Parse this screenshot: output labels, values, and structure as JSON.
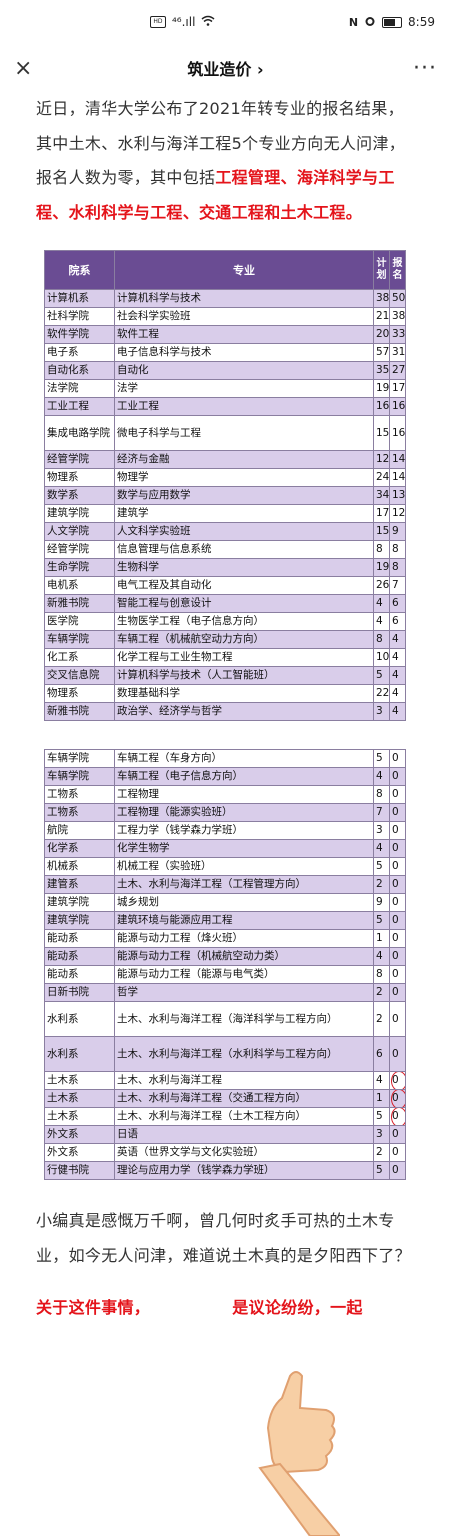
{
  "status_bar": {
    "left_icons": [
      "hd-icon",
      "signal-icon",
      "wifi-icon"
    ],
    "signal_text": "⁴⁶.ıll",
    "time": "8:59"
  },
  "nav": {
    "title": "筑业造价 ›",
    "close": "×",
    "more": "···"
  },
  "article": {
    "p1_normal": "近日，清华大学公布了2021年转专业的报名结果，其中土木、水利与海洋工程5个专业方向无人问津，报名人数为零，其中包括",
    "p1_highlight": "工程管理、海洋科学与工程、水利科学与工程、交通工程和土木工程。",
    "p2": "小编真是感慨万千啊，曾几何时炙手可热的土木专业，如今无人问津，难道说土木真的是夕阳西下了？",
    "p3_partial": "关于这件事情，              是议论纷纷，一起"
  },
  "table": {
    "headers": {
      "dept": "院系",
      "major": "专业",
      "plan": "计划",
      "apply": "报名"
    },
    "rows_top": [
      {
        "dept": "计算机系",
        "major": "计算机科学与技术",
        "plan": "38",
        "apply": "50"
      },
      {
        "dept": "社科学院",
        "major": "社会科学实验班",
        "plan": "21",
        "apply": "38"
      },
      {
        "dept": "软件学院",
        "major": "软件工程",
        "plan": "20",
        "apply": "33"
      },
      {
        "dept": "电子系",
        "major": "电子信息科学与技术",
        "plan": "57",
        "apply": "31"
      },
      {
        "dept": "自动化系",
        "major": "自动化",
        "plan": "35",
        "apply": "27"
      },
      {
        "dept": "法学院",
        "major": "法学",
        "plan": "19",
        "apply": "17"
      },
      {
        "dept": "工业工程",
        "major": "工业工程",
        "plan": "16",
        "apply": "16"
      },
      {
        "dept": "集成电路学院",
        "major": "微电子科学与工程",
        "plan": "15",
        "apply": "16"
      },
      {
        "dept": "经管学院",
        "major": "经济与金融",
        "plan": "12",
        "apply": "14"
      },
      {
        "dept": "物理系",
        "major": "物理学",
        "plan": "24",
        "apply": "14"
      },
      {
        "dept": "数学系",
        "major": "数学与应用数学",
        "plan": "34",
        "apply": "13"
      },
      {
        "dept": "建筑学院",
        "major": "建筑学",
        "plan": "17",
        "apply": "12"
      },
      {
        "dept": "人文学院",
        "major": "人文科学实验班",
        "plan": "15",
        "apply": "9"
      },
      {
        "dept": "经管学院",
        "major": "信息管理与信息系统",
        "plan": "8",
        "apply": "8"
      },
      {
        "dept": "生命学院",
        "major": "生物科学",
        "plan": "19",
        "apply": "8"
      },
      {
        "dept": "电机系",
        "major": "电气工程及其自动化",
        "plan": "26",
        "apply": "7"
      },
      {
        "dept": "新雅书院",
        "major": "智能工程与创意设计",
        "plan": "4",
        "apply": "6"
      },
      {
        "dept": "医学院",
        "major": "生物医学工程（电子信息方向）",
        "plan": "4",
        "apply": "6"
      },
      {
        "dept": "车辆学院",
        "major": "车辆工程（机械航空动力方向）",
        "plan": "8",
        "apply": "4"
      },
      {
        "dept": "化工系",
        "major": "化学工程与工业生物工程",
        "plan": "10",
        "apply": "4"
      },
      {
        "dept": "交叉信息院",
        "major": "计算机科学与技术（人工智能班）",
        "plan": "5",
        "apply": "4"
      },
      {
        "dept": "物理系",
        "major": "数理基础科学",
        "plan": "22",
        "apply": "4"
      },
      {
        "dept": "新雅书院",
        "major": "政治学、经济学与哲学",
        "plan": "3",
        "apply": "4"
      }
    ],
    "rows_bottom": [
      {
        "dept": "车辆学院",
        "major": "车辆工程（车身方向）",
        "plan": "5",
        "apply": "0"
      },
      {
        "dept": "车辆学院",
        "major": "车辆工程（电子信息方向）",
        "plan": "4",
        "apply": "0"
      },
      {
        "dept": "工物系",
        "major": "工程物理",
        "plan": "8",
        "apply": "0"
      },
      {
        "dept": "工物系",
        "major": "工程物理（能源实验班）",
        "plan": "7",
        "apply": "0"
      },
      {
        "dept": "航院",
        "major": "工程力学（钱学森力学班）",
        "plan": "3",
        "apply": "0"
      },
      {
        "dept": "化学系",
        "major": "化学生物学",
        "plan": "4",
        "apply": "0"
      },
      {
        "dept": "机械系",
        "major": "机械工程（实验班）",
        "plan": "5",
        "apply": "0"
      },
      {
        "dept": "建管系",
        "major": "土木、水利与海洋工程（工程管理方向）",
        "plan": "2",
        "apply": "0"
      },
      {
        "dept": "建筑学院",
        "major": "城乡规划",
        "plan": "9",
        "apply": "0"
      },
      {
        "dept": "建筑学院",
        "major": "建筑环境与能源应用工程",
        "plan": "5",
        "apply": "0"
      },
      {
        "dept": "能动系",
        "major": "能源与动力工程（烽火班）",
        "plan": "1",
        "apply": "0"
      },
      {
        "dept": "能动系",
        "major": "能源与动力工程（机械航空动力类）",
        "plan": "4",
        "apply": "0"
      },
      {
        "dept": "能动系",
        "major": "能源与动力工程（能源与电气类）",
        "plan": "8",
        "apply": "0"
      },
      {
        "dept": "日新书院",
        "major": "哲学",
        "plan": "2",
        "apply": "0"
      },
      {
        "dept": "水利系",
        "major": "土木、水利与海洋工程（海洋科学与工程方向）",
        "plan": "2",
        "apply": "0"
      },
      {
        "dept": "水利系",
        "major": "土木、水利与海洋工程（水利科学与工程方向）",
        "plan": "6",
        "apply": "0"
      },
      {
        "dept": "土木系",
        "major": "土木、水利与海洋工程",
        "plan": "4",
        "apply": "0"
      },
      {
        "dept": "土木系",
        "major": "土木、水利与海洋工程（交通工程方向）",
        "plan": "1",
        "apply": "0"
      },
      {
        "dept": "土木系",
        "major": "土木、水利与海洋工程（土木工程方向）",
        "plan": "5",
        "apply": "0"
      },
      {
        "dept": "外文系",
        "major": "日语",
        "plan": "3",
        "apply": "0"
      },
      {
        "dept": "外文系",
        "major": "英语（世界文学与文化实验班）",
        "plan": "2",
        "apply": "0"
      },
      {
        "dept": "行健书院",
        "major": "理论与应用力学（钱学森力学班）",
        "plan": "5",
        "apply": "0"
      }
    ]
  },
  "colors": {
    "highlight": "#e4141b",
    "table_header": "#6a4c93",
    "row_purple": "#d9cdea",
    "circle": "#d8202a"
  }
}
